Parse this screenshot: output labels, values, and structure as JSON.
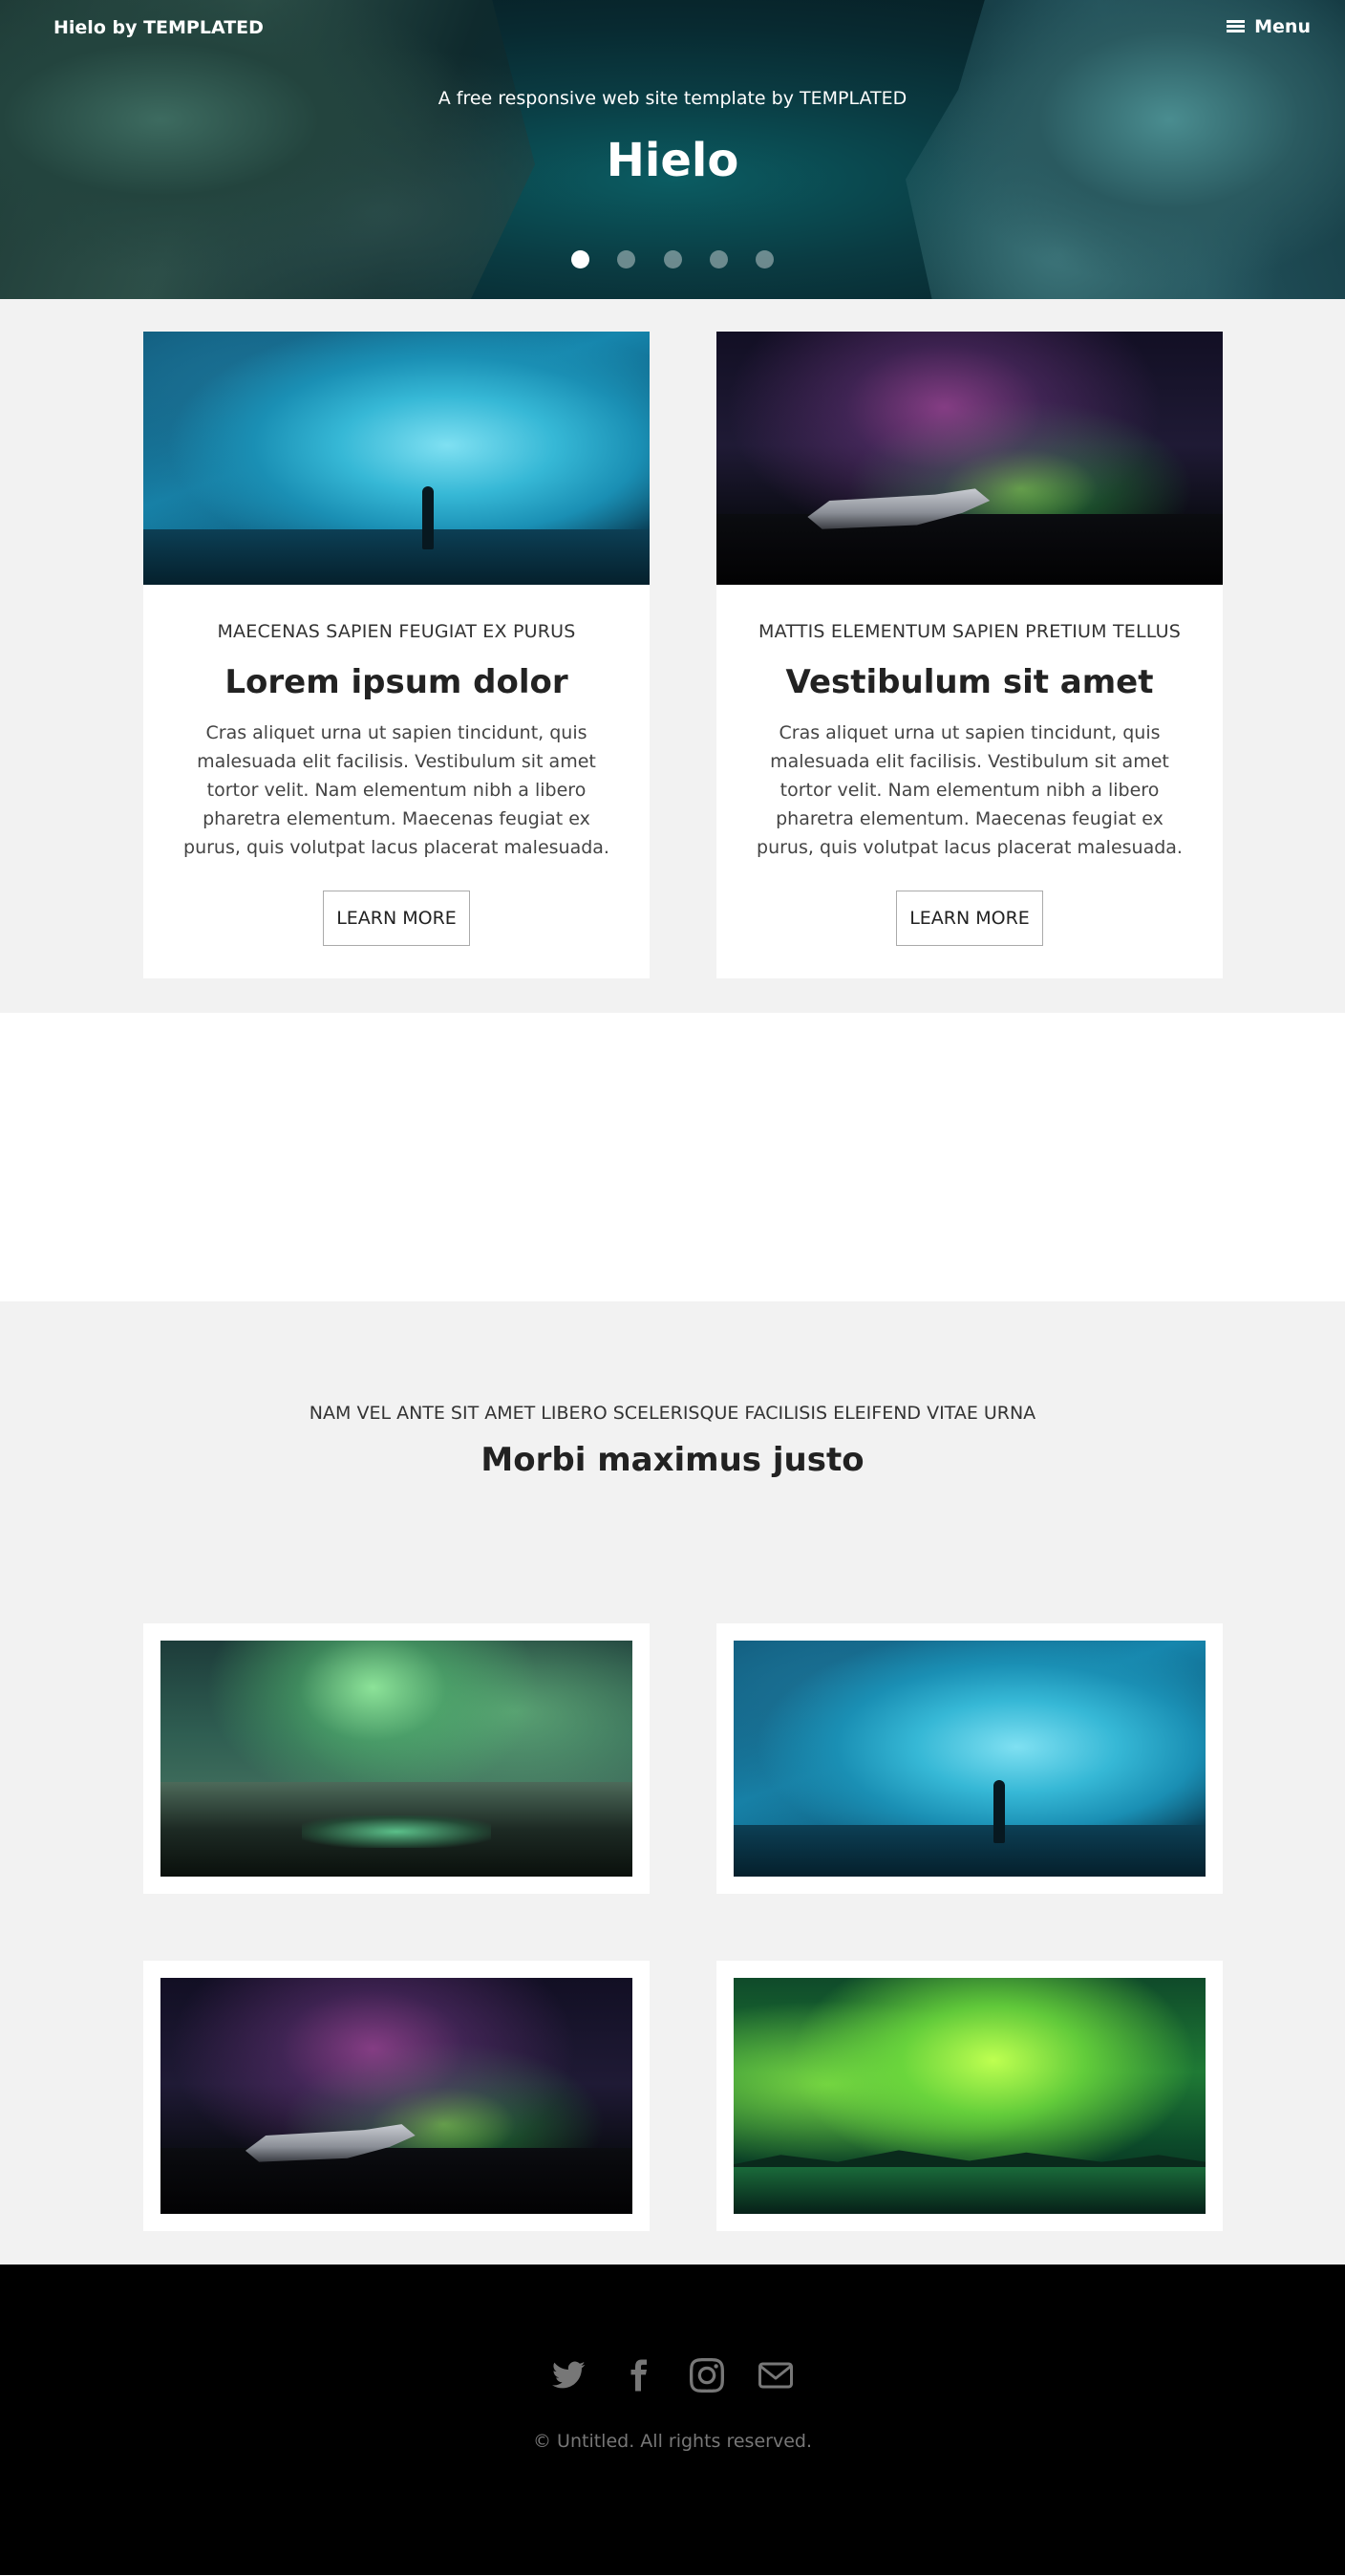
{
  "header": {
    "logo": "Hielo by TEMPLATED",
    "menu_label": "Menu",
    "menu_icon": "menu-icon",
    "tagline": "A free responsive web site template by TEMPLATED",
    "title": "Hielo",
    "slides": 5,
    "active_slide": 1
  },
  "features": [
    {
      "kicker": "MAECENAS SAPIEN FEUGIAT EX PURUS",
      "title": "Lorem ipsum dolor",
      "text": "Cras aliquet urna ut sapien tincidunt, quis malesuada elit facilisis. Vestibulum sit amet tortor velit. Nam elementum nibh a libero pharetra elementum. Maecenas feugiat ex purus, quis volutpat lacus placerat malesuada.",
      "button": "LEARN MORE"
    },
    {
      "kicker": "MATTIS ELEMENTUM SAPIEN PRETIUM TELLUS",
      "title": "Vestibulum sit amet",
      "text": "Cras aliquet urna ut sapien tincidunt, quis malesuada elit facilisis. Vestibulum sit amet tortor velit. Nam elementum nibh a libero pharetra elementum. Maecenas feugiat ex purus, quis volutpat lacus placerat malesuada.",
      "button": "LEARN MORE"
    }
  ],
  "gallery": {
    "kicker": "NAM VEL ANTE SIT AMET LIBERO SCELERISQUE FACILISIS ELEIFEND VITAE URNA",
    "title": "Morbi maximus justo"
  },
  "footer": {
    "icons": [
      "twitter-icon",
      "facebook-icon",
      "instagram-icon",
      "envelope-icon"
    ],
    "copyright": "© Untitled. All rights reserved."
  },
  "colors": {
    "section_bg": "#f2f2f2",
    "footer_bg": "#000000",
    "footer_text": "#777777"
  }
}
